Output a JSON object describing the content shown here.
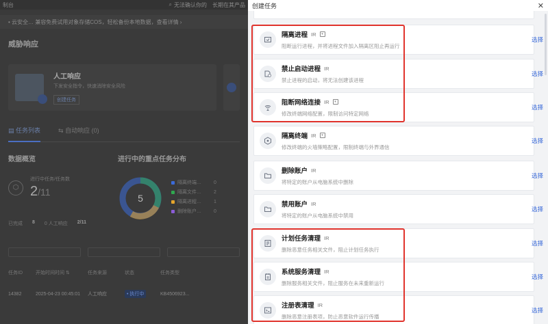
{
  "background_app": {
    "topbar_title": "制台",
    "topbar_search": "无法确认你的",
    "topbar_extra": "长期在其产品",
    "notice": "• 云安全… 兼容免费试用对象存储COS，轻松备份本地数据，查看详情 ›",
    "title": "威胁响应",
    "card_title": "人工响应",
    "card_desc": "下发安全指令，快速消除安全风险",
    "card_button": "创建任务",
    "tab_tasks": "任务列表",
    "tab_auto": "自动响应 (0)",
    "overview_title": "数据概览",
    "kpi_label": "进行中任务/任务数",
    "kpi_value": "2",
    "kpi_total": "/11",
    "stat_a_label": "已完成",
    "stat_a_value": "8",
    "stat_b_label": "0 人工响应",
    "stat_c_label": "2/11",
    "dist_title": "进行中的重点任务分布",
    "donut_value": "5",
    "legend": [
      {
        "label": "隔离终端…",
        "value": "0",
        "color": "#3b6bd9"
      },
      {
        "label": "隔离文件…",
        "value": "2",
        "color": "#2fa84f"
      },
      {
        "label": "隔离进程…",
        "value": "1",
        "color": "#e5a52c"
      },
      {
        "label": "删除账户…",
        "value": "0",
        "color": "#8b5cd6"
      }
    ],
    "table_headers": [
      "任务ID",
      "开始时间时间 ⇅",
      "任务来源",
      "状态",
      "任务类型"
    ],
    "table_row": [
      "14382",
      "2025-04-23 00:45:01",
      "人工响应",
      "• 执行中",
      "KB4506923..."
    ]
  },
  "drawer": {
    "title": "创建任务",
    "close_icon": "close-icon",
    "select_label": "选择",
    "items": [
      {
        "name": "隔离进程",
        "tag": "IR",
        "has_box": true,
        "desc": "阻断运行进程，并将进程文件加入隔离区阻止再运行",
        "icon": "process-isolate-icon"
      },
      {
        "name": "禁止启动进程",
        "tag": "IR",
        "has_box": false,
        "desc": "禁止进程的启动，将无法创建该进程",
        "icon": "process-block-icon"
      },
      {
        "name": "阻断网络连接",
        "tag": "IR",
        "has_box": true,
        "desc": "修改终端网络配置，限制访问特定网络",
        "icon": "network-block-icon"
      },
      {
        "name": "隔离终端",
        "tag": "IR",
        "has_box": true,
        "desc": "修改终端的火墙策略配置，限制终端与外界通信",
        "icon": "host-isolate-icon"
      },
      {
        "name": "删除账户",
        "tag": "IR",
        "has_box": false,
        "desc": "将特定的账户从电脑系统中删除",
        "icon": "folder-icon"
      },
      {
        "name": "禁用账户",
        "tag": "IR",
        "has_box": false,
        "desc": "将特定的账户从电脑系统中禁用",
        "icon": "folder-icon"
      },
      {
        "name": "计划任务清理",
        "tag": "IR",
        "has_box": false,
        "desc": "删除恶意任务相关文件，阻止计划任务执行",
        "icon": "task-clean-icon"
      },
      {
        "name": "系统服务清理",
        "tag": "IR",
        "has_box": false,
        "desc": "删除服务相关文件，阻止服务在未来重新运行",
        "icon": "service-clean-icon"
      },
      {
        "name": "注册表清理",
        "tag": "IR",
        "has_box": false,
        "desc": "删除恶意注册表项，防止恶意软件运行传播",
        "icon": "registry-clean-icon"
      }
    ]
  }
}
